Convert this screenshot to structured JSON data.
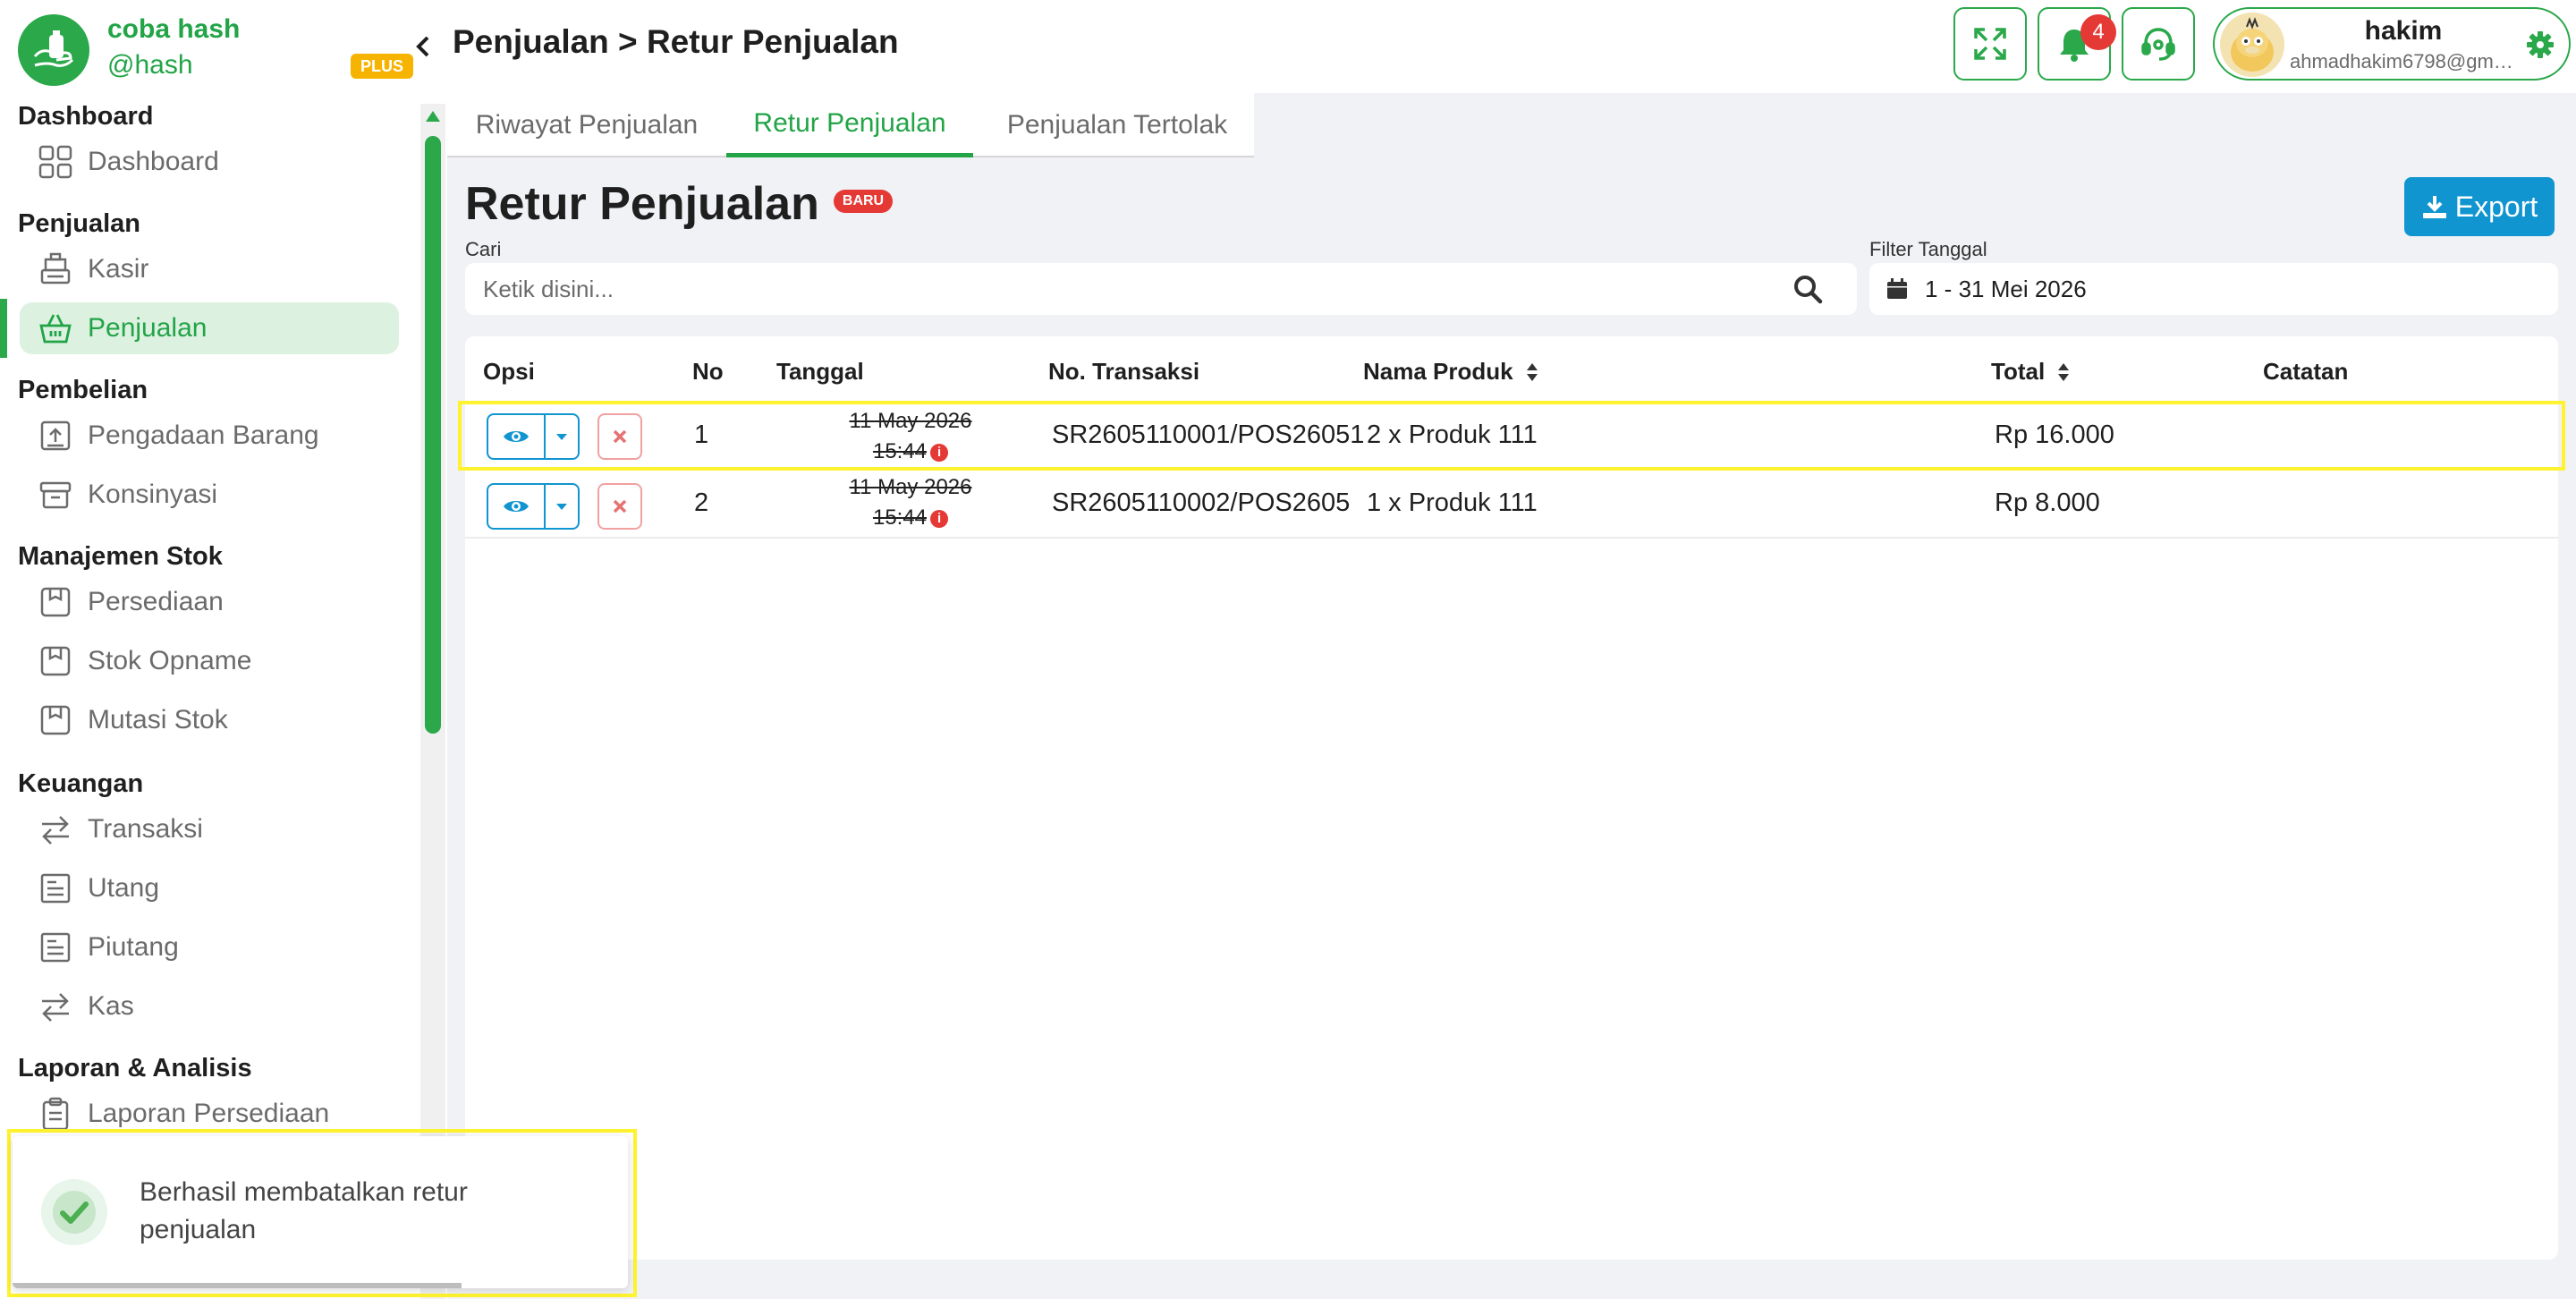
{
  "brand": {
    "name": "coba hash",
    "handle": "@hash",
    "plan_badge": "PLUS"
  },
  "sidebar": {
    "sections": [
      {
        "title": "Dashboard",
        "items": [
          {
            "label": "Dashboard",
            "icon": "grid-icon"
          }
        ]
      },
      {
        "title": "Penjualan",
        "items": [
          {
            "label": "Kasir",
            "icon": "cash-register-icon"
          },
          {
            "label": "Penjualan",
            "icon": "basket-icon",
            "active": true
          }
        ]
      },
      {
        "title": "Pembelian",
        "items": [
          {
            "label": "Pengadaan Barang",
            "icon": "box-upload-icon"
          },
          {
            "label": "Konsinyasi",
            "icon": "archive-icon"
          }
        ]
      },
      {
        "title": "Manajemen Stok",
        "items": [
          {
            "label": "Persediaan",
            "icon": "inventory-icon"
          },
          {
            "label": "Stok Opname",
            "icon": "inventory-icon"
          },
          {
            "label": "Mutasi Stok",
            "icon": "inventory-icon"
          }
        ]
      },
      {
        "title": "Keuangan",
        "items": [
          {
            "label": "Transaksi",
            "icon": "exchange-icon"
          },
          {
            "label": "Utang",
            "icon": "receipt-icon"
          },
          {
            "label": "Piutang",
            "icon": "receipt-icon"
          },
          {
            "label": "Kas",
            "icon": "exchange-icon"
          }
        ]
      },
      {
        "title": "Laporan & Analisis",
        "items": [
          {
            "label": "Laporan Persediaan",
            "icon": "clipboard-icon"
          }
        ]
      }
    ]
  },
  "header": {
    "breadcrumb": "Penjualan > Retur Penjualan",
    "notification_count": "4",
    "user": {
      "name": "hakim",
      "email": "ahmadhakim6798@gmail.com"
    }
  },
  "tabs": [
    {
      "label": "Riwayat Penjualan"
    },
    {
      "label": "Retur Penjualan",
      "active": true
    },
    {
      "label": "Penjualan Tertolak"
    }
  ],
  "page": {
    "title": "Retur Penjualan",
    "new_badge": "BARU",
    "export_label": "Export",
    "search": {
      "label": "Cari",
      "placeholder": "Ketik disini..."
    },
    "date_filter": {
      "label": "Filter Tanggal",
      "value": "1 - 31 Mei 2026"
    }
  },
  "table": {
    "columns": [
      "Opsi",
      "No",
      "Tanggal",
      "No. Transaksi",
      "Nama Produk",
      "Total",
      "Catatan"
    ],
    "rows": [
      {
        "no": "1",
        "date": "11 May 2026",
        "time": "15:44",
        "transaction": "SR2605110001/POS26051",
        "product": "2 x Produk 111",
        "total": "Rp 16.000",
        "note": ""
      },
      {
        "no": "2",
        "date": "11 May 2026",
        "time": "15:44",
        "transaction": "SR2605110002/POS2605",
        "product": "1 x Produk 111",
        "total": "Rp 8.000",
        "note": ""
      }
    ]
  },
  "toast": {
    "message": "Berhasil membatalkan retur penjualan",
    "icon": "check-circle-icon",
    "progress": 0.73
  },
  "colors": {
    "primary": "#2aa84a",
    "accent": "#1195d0",
    "danger": "#e53935",
    "highlight": "#fff22e"
  }
}
